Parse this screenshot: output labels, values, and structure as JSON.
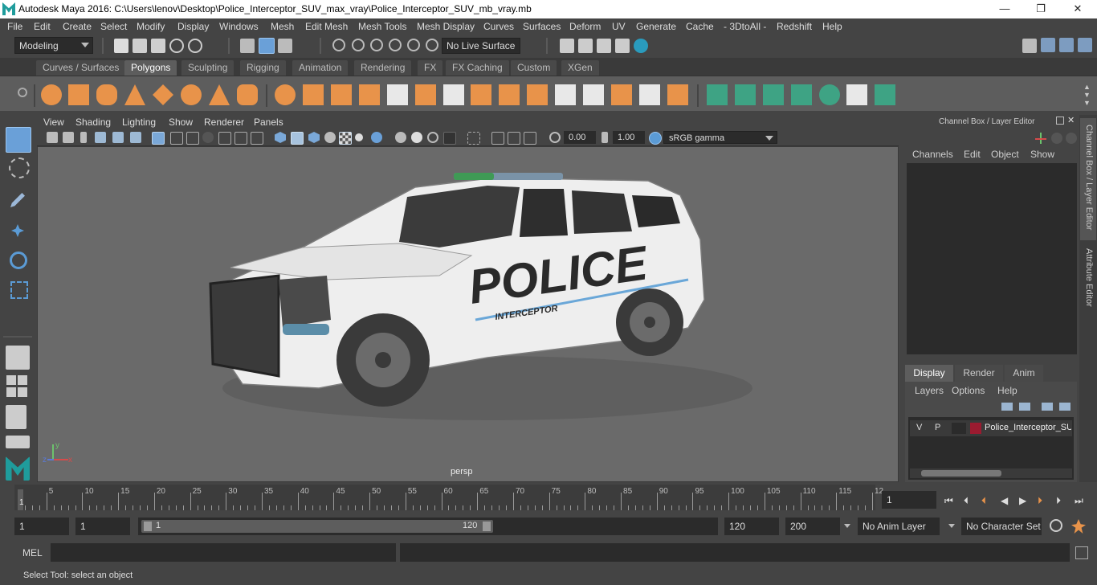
{
  "window": {
    "title": "Autodesk Maya 2016: C:\\Users\\lenov\\Desktop\\Police_Interceptor_SUV_max_vray\\Police_Interceptor_SUV_mb_vray.mb",
    "minimize": "—",
    "restore": "❐",
    "close": "✕"
  },
  "menu": [
    "File",
    "Edit",
    "Create",
    "Select",
    "Modify",
    "Display",
    "Windows",
    "Mesh",
    "Edit Mesh",
    "Mesh Tools",
    "Mesh Display",
    "Curves",
    "Surfaces",
    "Deform",
    "UV",
    "Generate",
    "Cache",
    "- 3DtoAll -",
    "Redshift",
    "Help"
  ],
  "status_line": {
    "mode": "Modeling",
    "live_surface": "No Live Surface"
  },
  "shelf_tabs": [
    {
      "label": "Curves / Surfaces",
      "active": false
    },
    {
      "label": "Polygons",
      "active": true
    },
    {
      "label": "Sculpting",
      "active": false
    },
    {
      "label": "Rigging",
      "active": false
    },
    {
      "label": "Animation",
      "active": false
    },
    {
      "label": "Rendering",
      "active": false
    },
    {
      "label": "FX",
      "active": false
    },
    {
      "label": "FX Caching",
      "active": false
    },
    {
      "label": "Custom",
      "active": false
    },
    {
      "label": "XGen",
      "active": false
    }
  ],
  "viewport": {
    "menu": [
      "View",
      "Shading",
      "Lighting",
      "Show",
      "Renderer",
      "Panels"
    ],
    "exposure": "0.00",
    "gamma": "1.00",
    "color_space": "sRGB gamma",
    "camera_label": "persp",
    "car_text": "POLICE",
    "car_subtext": "INTERCEPTOR",
    "axis_x": "x",
    "axis_y": "y",
    "axis_z": "z"
  },
  "channel_box": {
    "title": "Channel Box / Layer Editor",
    "menu": [
      "Channels",
      "Edit",
      "Object",
      "Show"
    ]
  },
  "layer_editor": {
    "tabs": [
      {
        "label": "Display",
        "active": true
      },
      {
        "label": "Render",
        "active": false
      },
      {
        "label": "Anim",
        "active": false
      }
    ],
    "menu": [
      "Layers",
      "Options",
      "Help"
    ],
    "layer": {
      "v": "V",
      "p": "P",
      "name": "Police_Interceptor_SUV",
      "color": "#9b1b30"
    }
  },
  "side_tabs": [
    "Channel Box / Layer Editor",
    "Attribute Editor"
  ],
  "timeline": {
    "ticks": [
      "5",
      "10",
      "15",
      "20",
      "25",
      "30",
      "35",
      "40",
      "45",
      "50",
      "55",
      "60",
      "65",
      "70",
      "75",
      "80",
      "85",
      "90",
      "95",
      "100",
      "105",
      "110",
      "115",
      "12"
    ],
    "start_label": "1",
    "current_frame": "1"
  },
  "range": {
    "start": "1",
    "playback_start": "1",
    "slider_start": "1",
    "slider_end": "120",
    "playback_end": "120",
    "end": "200",
    "anim_layer": "No Anim Layer",
    "character_set": "No Character Set"
  },
  "command_line": {
    "label": "MEL"
  },
  "help_line": "Select Tool: select an object",
  "colors": {
    "shelf_orange": "#e8934a",
    "shelf_green": "#3ea384",
    "accent_blue": "#5b9bd5"
  }
}
